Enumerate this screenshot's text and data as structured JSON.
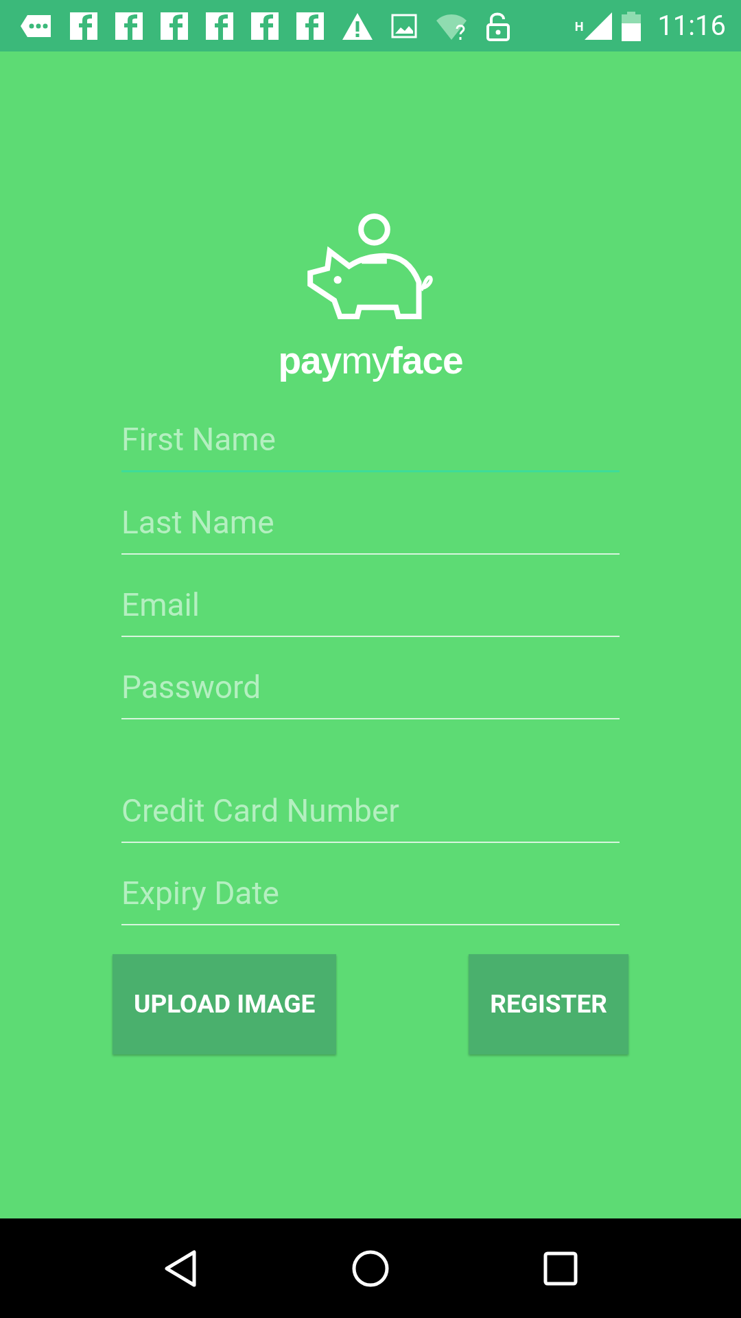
{
  "status_bar": {
    "icons": [
      {
        "kind": "more"
      },
      {
        "kind": "facebook"
      },
      {
        "kind": "facebook"
      },
      {
        "kind": "facebook"
      },
      {
        "kind": "facebook"
      },
      {
        "kind": "facebook"
      },
      {
        "kind": "facebook"
      },
      {
        "kind": "warning"
      },
      {
        "kind": "image"
      },
      {
        "kind": "wifi"
      },
      {
        "kind": "lock"
      }
    ],
    "network_type": "H",
    "time": "11:16"
  },
  "logo": {
    "wordmark": "**pay**my**face**"
  },
  "account_fields": [
    {
      "placeholder": "First Name",
      "focused": true
    },
    {
      "placeholder": "Last Name",
      "focused": false
    },
    {
      "placeholder": "Email",
      "focused": false
    },
    {
      "placeholder": "Password",
      "focused": false
    }
  ],
  "card_fields": [
    {
      "placeholder": "Credit Card Number",
      "focused": false
    },
    {
      "placeholder": "Expiry Date",
      "focused": false
    }
  ],
  "buttons": [
    {
      "label": "UPLOAD IMAGE"
    },
    {
      "label": "REGISTER"
    }
  ]
}
